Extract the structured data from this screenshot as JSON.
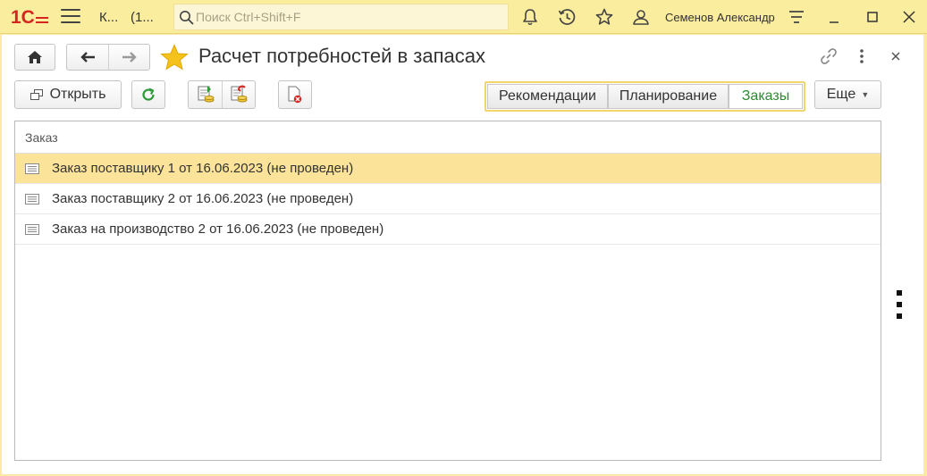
{
  "topbar": {
    "logo_text": "1С",
    "app_abbr": "К...",
    "app_count": "(1...",
    "search_placeholder": "Поиск Ctrl+Shift+F",
    "user_name": "Семенов Александр"
  },
  "form": {
    "title": "Расчет потребностей в запасах",
    "open_label": "Открыть",
    "more_label": "Еще",
    "tabs": [
      {
        "label": "Рекомендации",
        "active": false
      },
      {
        "label": "Планирование",
        "active": false
      },
      {
        "label": "Заказы",
        "active": true
      }
    ]
  },
  "table": {
    "column_header": "Заказ",
    "rows": [
      {
        "text": "Заказ поставщику 1 от 16.06.2023 (не проведен)",
        "selected": true
      },
      {
        "text": "Заказ поставщику 2 от 16.06.2023 (не проведен)",
        "selected": false
      },
      {
        "text": "Заказ на производство 2 от 16.06.2023 (не проведен)",
        "selected": false
      }
    ]
  },
  "colors": {
    "topbar_bg": "#fbed9e",
    "selected_row": "#fbe39a",
    "active_tab_text": "#2f8a34",
    "logo_red": "#d6241f",
    "star_yellow": "#f4c21b"
  }
}
